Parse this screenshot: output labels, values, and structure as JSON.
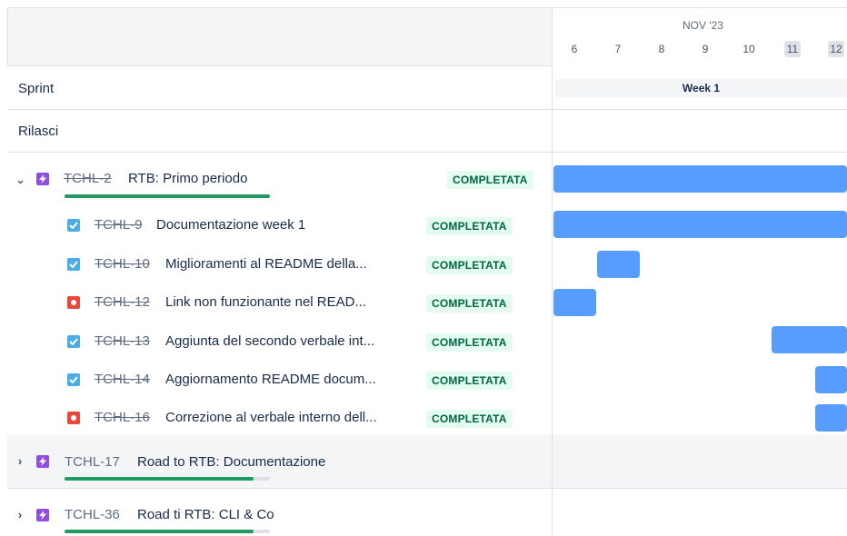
{
  "timeline": {
    "month": "NOV '23",
    "days": [
      {
        "label": "6",
        "weekend": false
      },
      {
        "label": "7",
        "weekend": false
      },
      {
        "label": "8",
        "weekend": false
      },
      {
        "label": "9",
        "weekend": false
      },
      {
        "label": "10",
        "weekend": false
      },
      {
        "label": "11",
        "weekend": true
      },
      {
        "label": "12",
        "weekend": true
      }
    ],
    "sprint_label": "Week 1"
  },
  "rows": {
    "sprint": "Sprint",
    "releases": "Rilasci"
  },
  "epics": [
    {
      "key": "TCHL-2",
      "summary": "RTB: Primo periodo",
      "status": "COMPLETATA",
      "done": true,
      "expanded": true,
      "progress": 1.0,
      "children": [
        {
          "type": "task",
          "key": "TCHL-9",
          "summary": "Documentazione week 1",
          "status": "COMPLETATA"
        },
        {
          "type": "task",
          "key": "TCHL-10",
          "summary": "Miglioramenti al README della...",
          "status": "COMPLETATA"
        },
        {
          "type": "bug",
          "key": "TCHL-12",
          "summary": "Link non funzionante nel READ...",
          "status": "COMPLETATA"
        },
        {
          "type": "task",
          "key": "TCHL-13",
          "summary": "Aggiunta del secondo verbale int...",
          "status": "COMPLETATA"
        },
        {
          "type": "task",
          "key": "TCHL-14",
          "summary": "Aggiornamento README docum...",
          "status": "COMPLETATA"
        },
        {
          "type": "bug",
          "key": "TCHL-16",
          "summary": "Correzione al verbale interno dell...",
          "status": "COMPLETATA"
        }
      ]
    },
    {
      "key": "TCHL-17",
      "summary": "Road to RTB: Documentazione",
      "done": false,
      "expanded": false,
      "progress": 0.92
    },
    {
      "key": "TCHL-36",
      "summary": "Road ti RTB: CLI & Co",
      "done": false,
      "expanded": false,
      "progress": 0.92
    }
  ],
  "colors": {
    "accent": "#579dff",
    "epic": "#904ee2",
    "task": "#4bade8",
    "bug": "#e5493a",
    "status_bg": "#e3fcef",
    "status_text": "#006644",
    "progress": "#1f9b5f"
  }
}
